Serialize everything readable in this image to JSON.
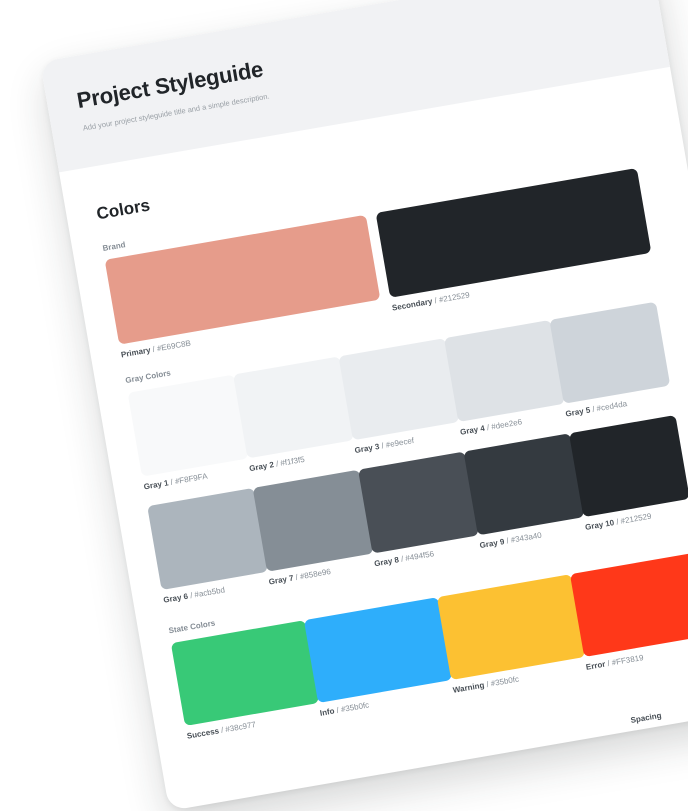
{
  "header": {
    "title": "Project Styleguide",
    "subtitle": "Add your project styleguide title and a simple description."
  },
  "colors_section": {
    "heading": "Colors",
    "brand": {
      "label": "Brand",
      "primary": {
        "name": "Primary",
        "hex": "#E69C8B",
        "color": "#E69C8B"
      },
      "secondary": {
        "name": "Secondary",
        "hex": "#212529",
        "color": "#212529"
      }
    },
    "gray": {
      "label": "Gray Colors",
      "items": [
        {
          "name": "Gray 1",
          "hex": "#F8F9FA",
          "color": "#F8F9FA"
        },
        {
          "name": "Gray 2",
          "hex": "#f1f3f5",
          "color": "#f1f3f5"
        },
        {
          "name": "Gray 3",
          "hex": "#e9ecef",
          "color": "#e9ecef"
        },
        {
          "name": "Gray 4",
          "hex": "#dee2e6",
          "color": "#dee2e6"
        },
        {
          "name": "Gray 5",
          "hex": "#ced4da",
          "color": "#ced4da"
        },
        {
          "name": "Gray 6",
          "hex": "#acb5bd",
          "color": "#acb5bd"
        },
        {
          "name": "Gray 7",
          "hex": "#858e96",
          "color": "#858e96"
        },
        {
          "name": "Gray 8",
          "hex": "#494f56",
          "color": "#494f56"
        },
        {
          "name": "Gray 9",
          "hex": "#343a40",
          "color": "#343a40"
        },
        {
          "name": "Gray 10",
          "hex": "#212529",
          "color": "#212529"
        }
      ]
    },
    "state": {
      "label": "State Colors",
      "items": [
        {
          "name": "Success",
          "hex": "#38c977",
          "color": "#38c977"
        },
        {
          "name": "Info",
          "hex": "#35b0fc",
          "color": "#2eaefb"
        },
        {
          "name": "Warning",
          "hex": "#35b0fc",
          "color": "#fcc132"
        },
        {
          "name": "Error",
          "hex": "#FF3819",
          "color": "#FF3819"
        }
      ]
    }
  },
  "footer": {
    "spacing_label": "Spacing"
  }
}
